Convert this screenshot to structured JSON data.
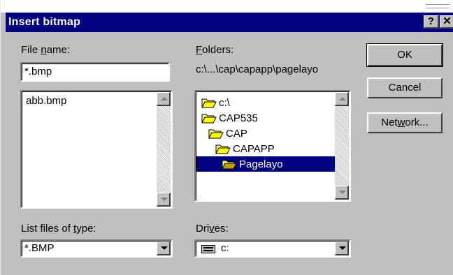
{
  "dialog": {
    "title": "Insert bitmap",
    "help_label": "?",
    "close_label": "✕"
  },
  "file_name": {
    "label_pre": "File ",
    "label_u": "n",
    "label_post": "ame:",
    "value": "*.bmp"
  },
  "files": [
    "abb.bmp"
  ],
  "folders": {
    "label_u": "F",
    "label_post": "olders:",
    "current_path": "c:\\...\\cap\\capapp\\pagelayo",
    "items": [
      "c:\\",
      "CAP535",
      "CAP",
      "CAPAPP",
      "Pagelayo"
    ]
  },
  "buttons": {
    "ok": "OK",
    "cancel": "Cancel",
    "network_pre": "Net",
    "network_u": "w",
    "network_post": "ork..."
  },
  "file_type": {
    "label_pre": "List files of ",
    "label_u": "t",
    "label_post": "ype:",
    "value": "*.BMP"
  },
  "drives": {
    "label_pre": "Dri",
    "label_u": "v",
    "label_post": "es:",
    "value": "c:"
  }
}
